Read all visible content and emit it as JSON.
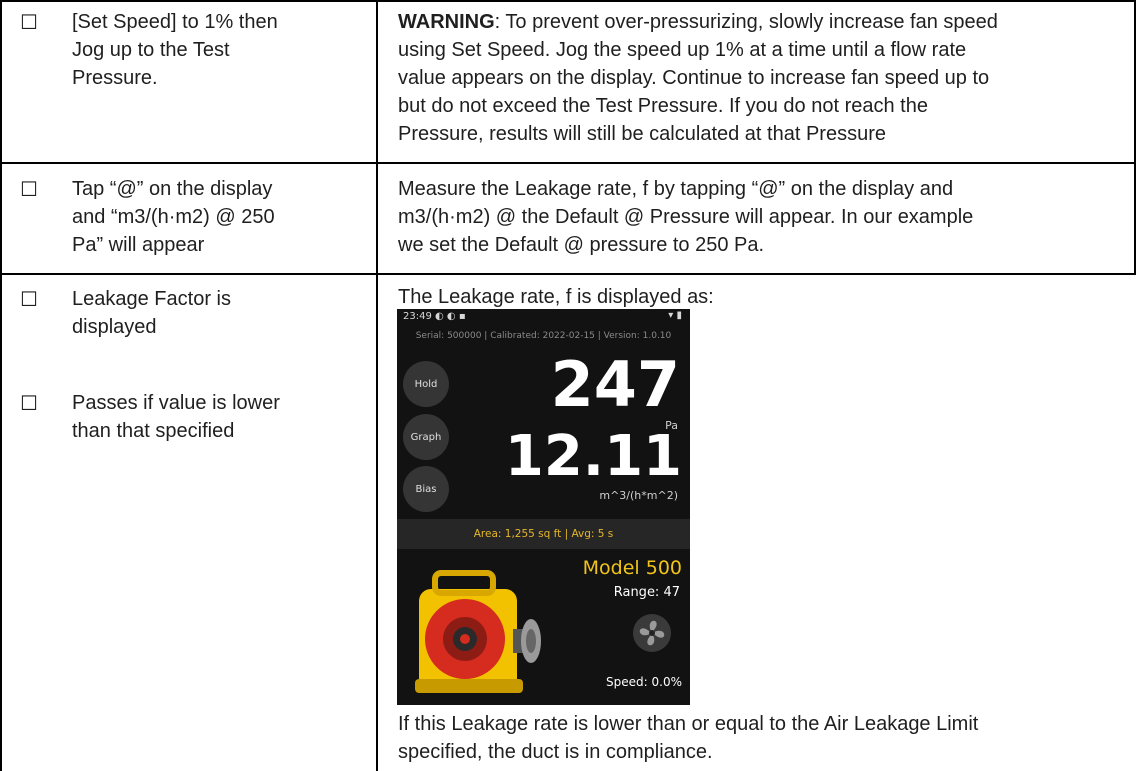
{
  "checkbox_glyph": "☐",
  "rows": [
    {
      "steps": [
        [
          "[Set Speed] to 1% then",
          "Jog up to the Test",
          "Pressure."
        ]
      ],
      "description": {
        "warning_label": "WARNING",
        "lines": [
          ": To prevent over-pressurizing, slowly increase fan speed",
          "using Set Speed.  Jog the speed up 1% at a time until a flow rate",
          "value appears on the display.  Continue to increase fan speed up to",
          "but do not exceed the Test Pressure.  If you do not reach the",
          "Pressure, results will still be calculated at that Pressure"
        ]
      }
    },
    {
      "steps": [
        [
          "Tap “@” on the display",
          "and “m3/(h·m2) @ 250",
          "Pa” will appear"
        ]
      ],
      "description": {
        "lines": [
          "Measure the Leakage rate, f by tapping “@” on the display and",
          "m3/(h·m2) @ the Default @ Pressure will appear.  In our example",
          "we set the Default @ pressure to 250 Pa."
        ]
      }
    },
    {
      "steps": [
        [
          "Leakage Factor is",
          "displayed"
        ],
        [
          "Passes if value is lower",
          "than that specified"
        ]
      ],
      "description": {
        "intro": "The Leakage rate, f is displayed as:",
        "outro_lines": [
          "If this Leakage rate is lower than or equal to the Air Leakage Limit",
          "specified, the duct is in compliance."
        ]
      }
    }
  ],
  "device_screen": {
    "status_time": "23:49",
    "status_icons": "◐ ◐ ▪",
    "signal_icons": "▾ ▮",
    "meta": "Serial: 500000 | Calibrated: 2022-02-15 | Version: 1.0.10",
    "buttons": [
      "Hold",
      "Graph",
      "Bias"
    ],
    "pressure_value": "247",
    "pressure_unit": "Pa",
    "leakage_value": "12.11",
    "leakage_unit": "m^3/(h*m^2)",
    "info_bar": "Area: 1,255 sq ft | Avg: 5 s",
    "model": "Model 500",
    "range": "Range: 47",
    "speed": "Speed: 0.0%",
    "colors": {
      "background": "#121212",
      "accent": "#f0c419",
      "device_body": "#f2c200",
      "device_face": "#d62b1f"
    }
  }
}
